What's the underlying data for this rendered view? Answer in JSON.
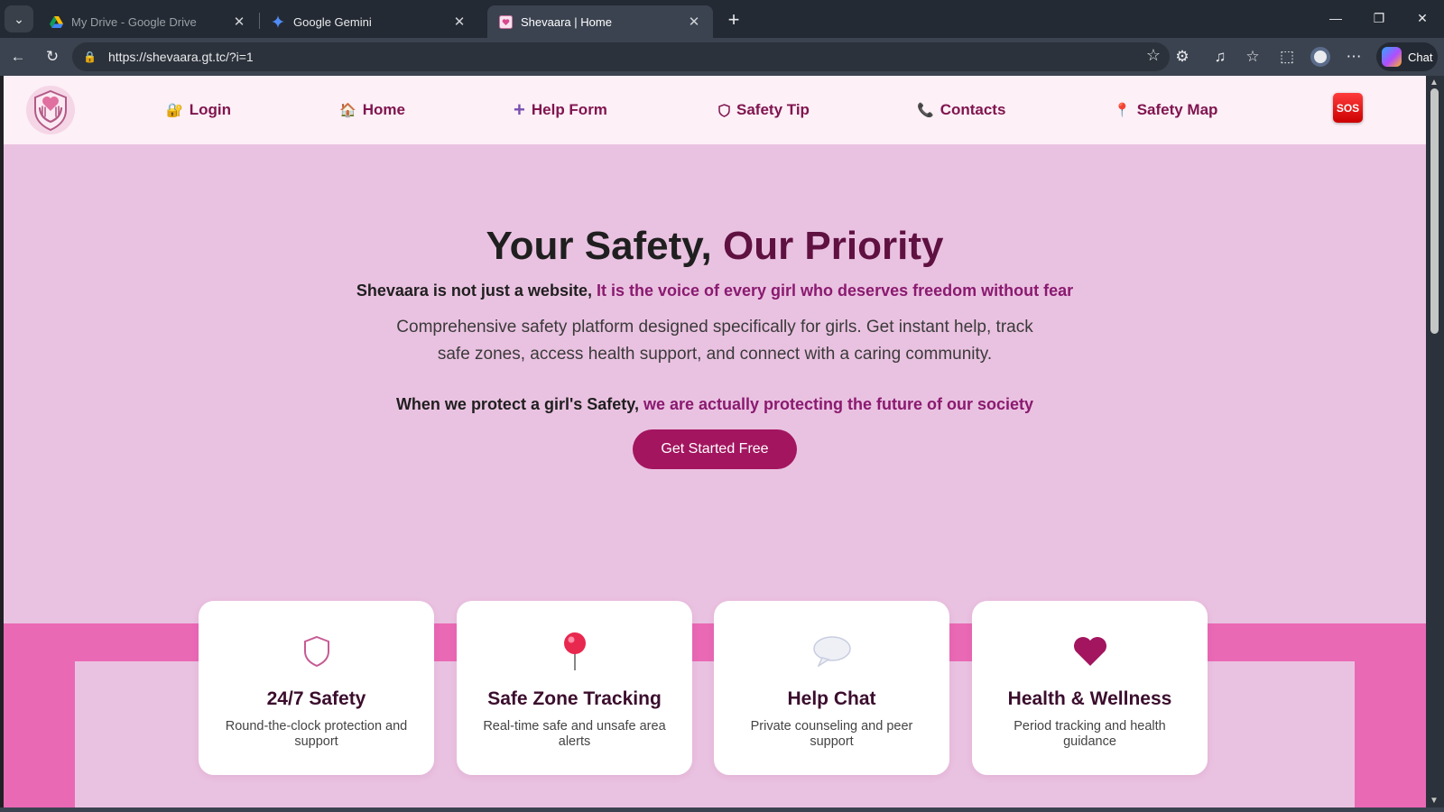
{
  "browser": {
    "tabs": [
      {
        "title": "My Drive - Google Drive",
        "favicon": "google-drive-icon",
        "active": false
      },
      {
        "title": "Google Gemini",
        "favicon": "gemini-icon",
        "active": false
      },
      {
        "title": "Shevaara | Home",
        "favicon": "shevaara-favicon",
        "active": true
      }
    ],
    "url": "https://shevaara.gt.tc/?i=1",
    "chat_label": "Chat"
  },
  "nav": {
    "items": [
      {
        "label": "Login",
        "icon": "lock-icon"
      },
      {
        "label": "Home",
        "icon": "house-icon"
      },
      {
        "label": "Help Form",
        "icon": "plus-icon"
      },
      {
        "label": "Safety Tip",
        "icon": "shield-icon"
      },
      {
        "label": "Contacts",
        "icon": "phone-icon"
      },
      {
        "label": "Safety Map",
        "icon": "map-pin-icon"
      }
    ],
    "sos_label": "SOS"
  },
  "hero": {
    "title_plain": "Your Safety, ",
    "title_accent": "Our Priority",
    "tagline_plain": "Shevaara is not just a website, ",
    "tagline_accent": "It is the voice of every girl who deserves freedom without fear",
    "description": "Comprehensive safety platform designed specifically for girls. Get instant help, track safe zones, access health support, and connect with a caring community.",
    "tagline2_plain": "When we protect a girl's Safety, ",
    "tagline2_accent": "we are actually protecting the future of our society",
    "cta_label": "Get Started Free"
  },
  "features": [
    {
      "title": "24/7 Safety",
      "description": "Round-the-clock protection and support",
      "icon": "shield-icon"
    },
    {
      "title": "Safe Zone Tracking",
      "description": "Real-time safe and unsafe area alerts",
      "icon": "map-pin-icon"
    },
    {
      "title": "Help Chat",
      "description": "Private counseling and peer support",
      "icon": "speech-bubble-icon"
    },
    {
      "title": "Health & Wellness",
      "description": "Period tracking and health guidance",
      "icon": "heart-icon"
    }
  ],
  "colors": {
    "brand_dark": "#80154f",
    "accent": "#a3155f",
    "hero_bg": "#eac2e1",
    "band_bg": "#ea69b5",
    "sos_red": "#e01010"
  }
}
